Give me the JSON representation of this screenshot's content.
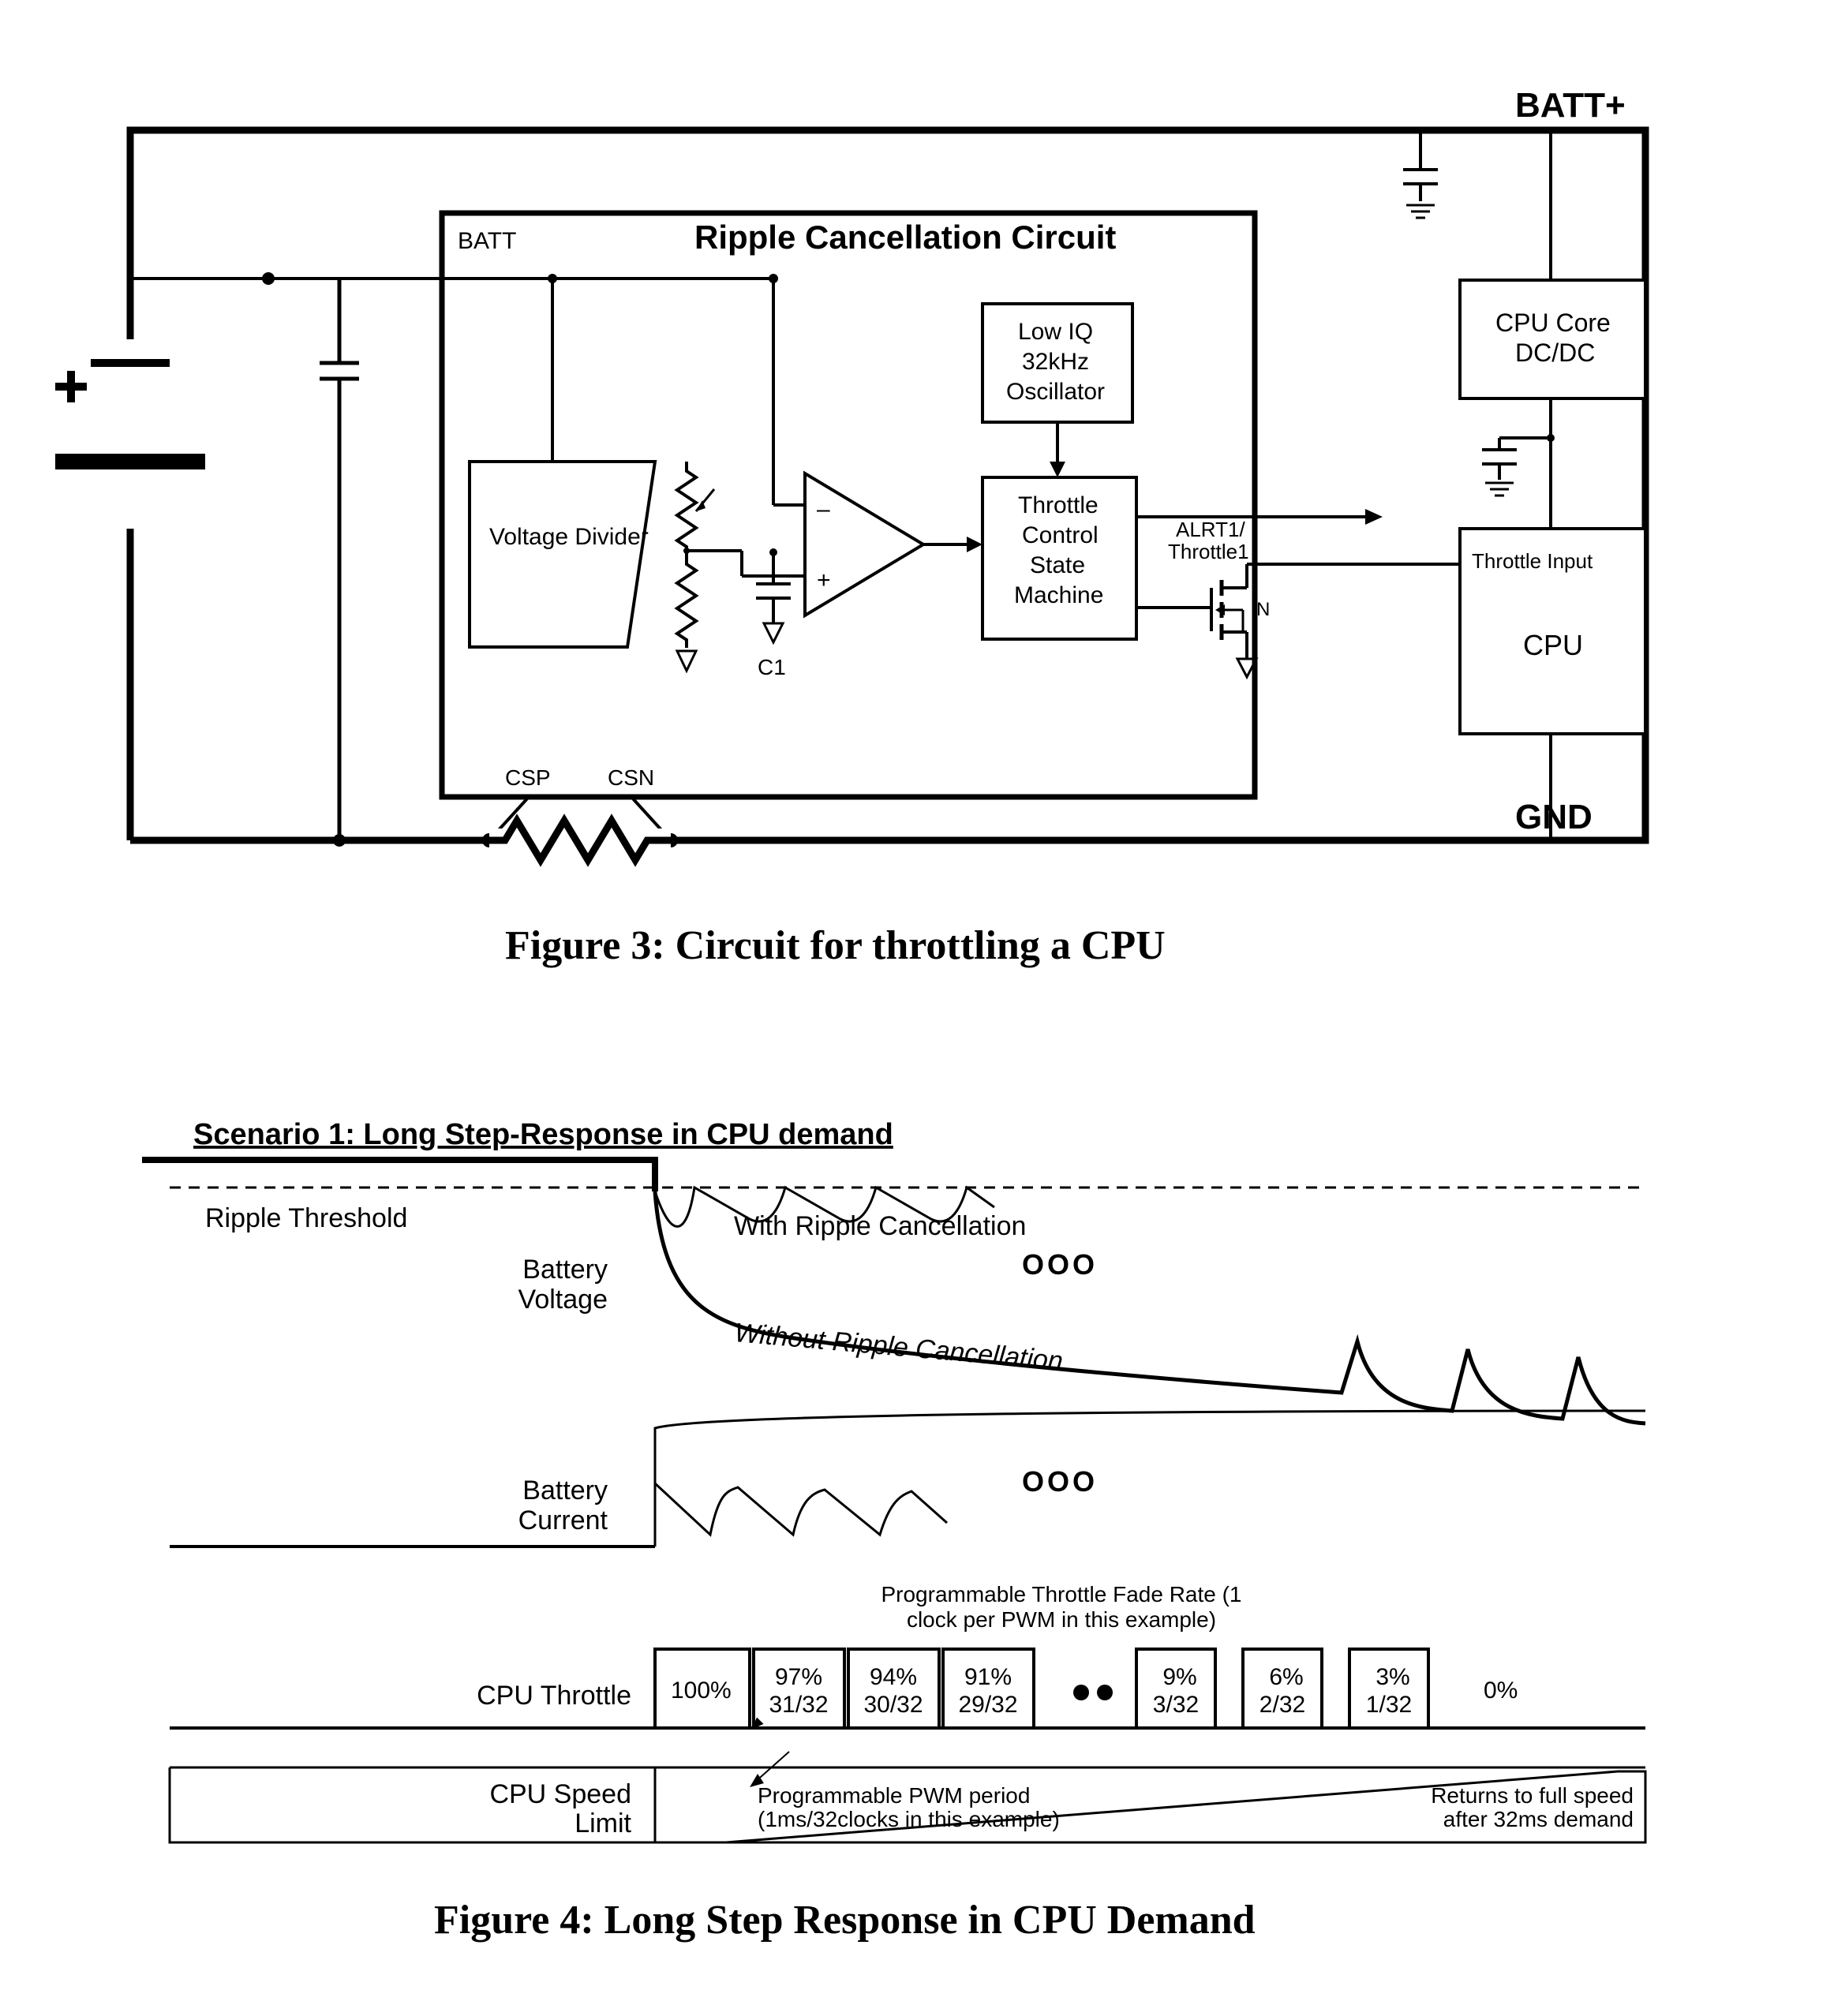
{
  "fig3": {
    "caption": "Figure 3:  Circuit for throttling a CPU",
    "title": "Ripple Cancellation Circuit",
    "labels": {
      "batt_plus": "BATT+",
      "gnd": "GND",
      "batt_pin": "BATT",
      "csp": "CSP",
      "csn": "CSN",
      "c1": "C1",
      "voltage_divider": "Voltage\nDivider",
      "oscillator": "Low IQ\n32kHz\nOscillator",
      "state_machine": "Throttle\nControl\nState\nMachine",
      "alrt": "ALRT1/\nThrottle1",
      "mosfet_n": "N",
      "throttle_input": "Throttle Input",
      "cpu": "CPU",
      "cpu_core": "CPU Core\nDC/DC"
    }
  },
  "fig4": {
    "caption": "Figure 4:  Long Step Response in CPU Demand",
    "scenario_title": "Scenario 1:  Long Step-Response in CPU demand",
    "labels": {
      "ripple_threshold": "Ripple Threshold",
      "battery_voltage": "Battery\nVoltage",
      "with_rc": "With Ripple Cancellation",
      "without_rc": "Without Ripple Cancellation",
      "battery_current": "Battery\nCurrent",
      "cpu_throttle": "CPU Throttle",
      "cpu_speed_limit": "CPU Speed\nLimit",
      "fade_rate": "Programmable Throttle Fade Rate (1\nclock per PWM in this example)",
      "pwm_period": "Programmable PWM period\n(1ms/32clocks in this example)",
      "returns": "Returns to full speed\nafter 32ms demand",
      "ooo": "OOO"
    },
    "throttle_steps": [
      {
        "pct": "100%",
        "frac": ""
      },
      {
        "pct": "97%",
        "frac": "31/32"
      },
      {
        "pct": "94%",
        "frac": "30/32"
      },
      {
        "pct": "91%",
        "frac": "29/32"
      },
      {
        "pct": "9%",
        "frac": "3/32"
      },
      {
        "pct": "6%",
        "frac": "2/32"
      },
      {
        "pct": "3%",
        "frac": "1/32"
      },
      {
        "pct": "0%",
        "frac": ""
      }
    ]
  }
}
